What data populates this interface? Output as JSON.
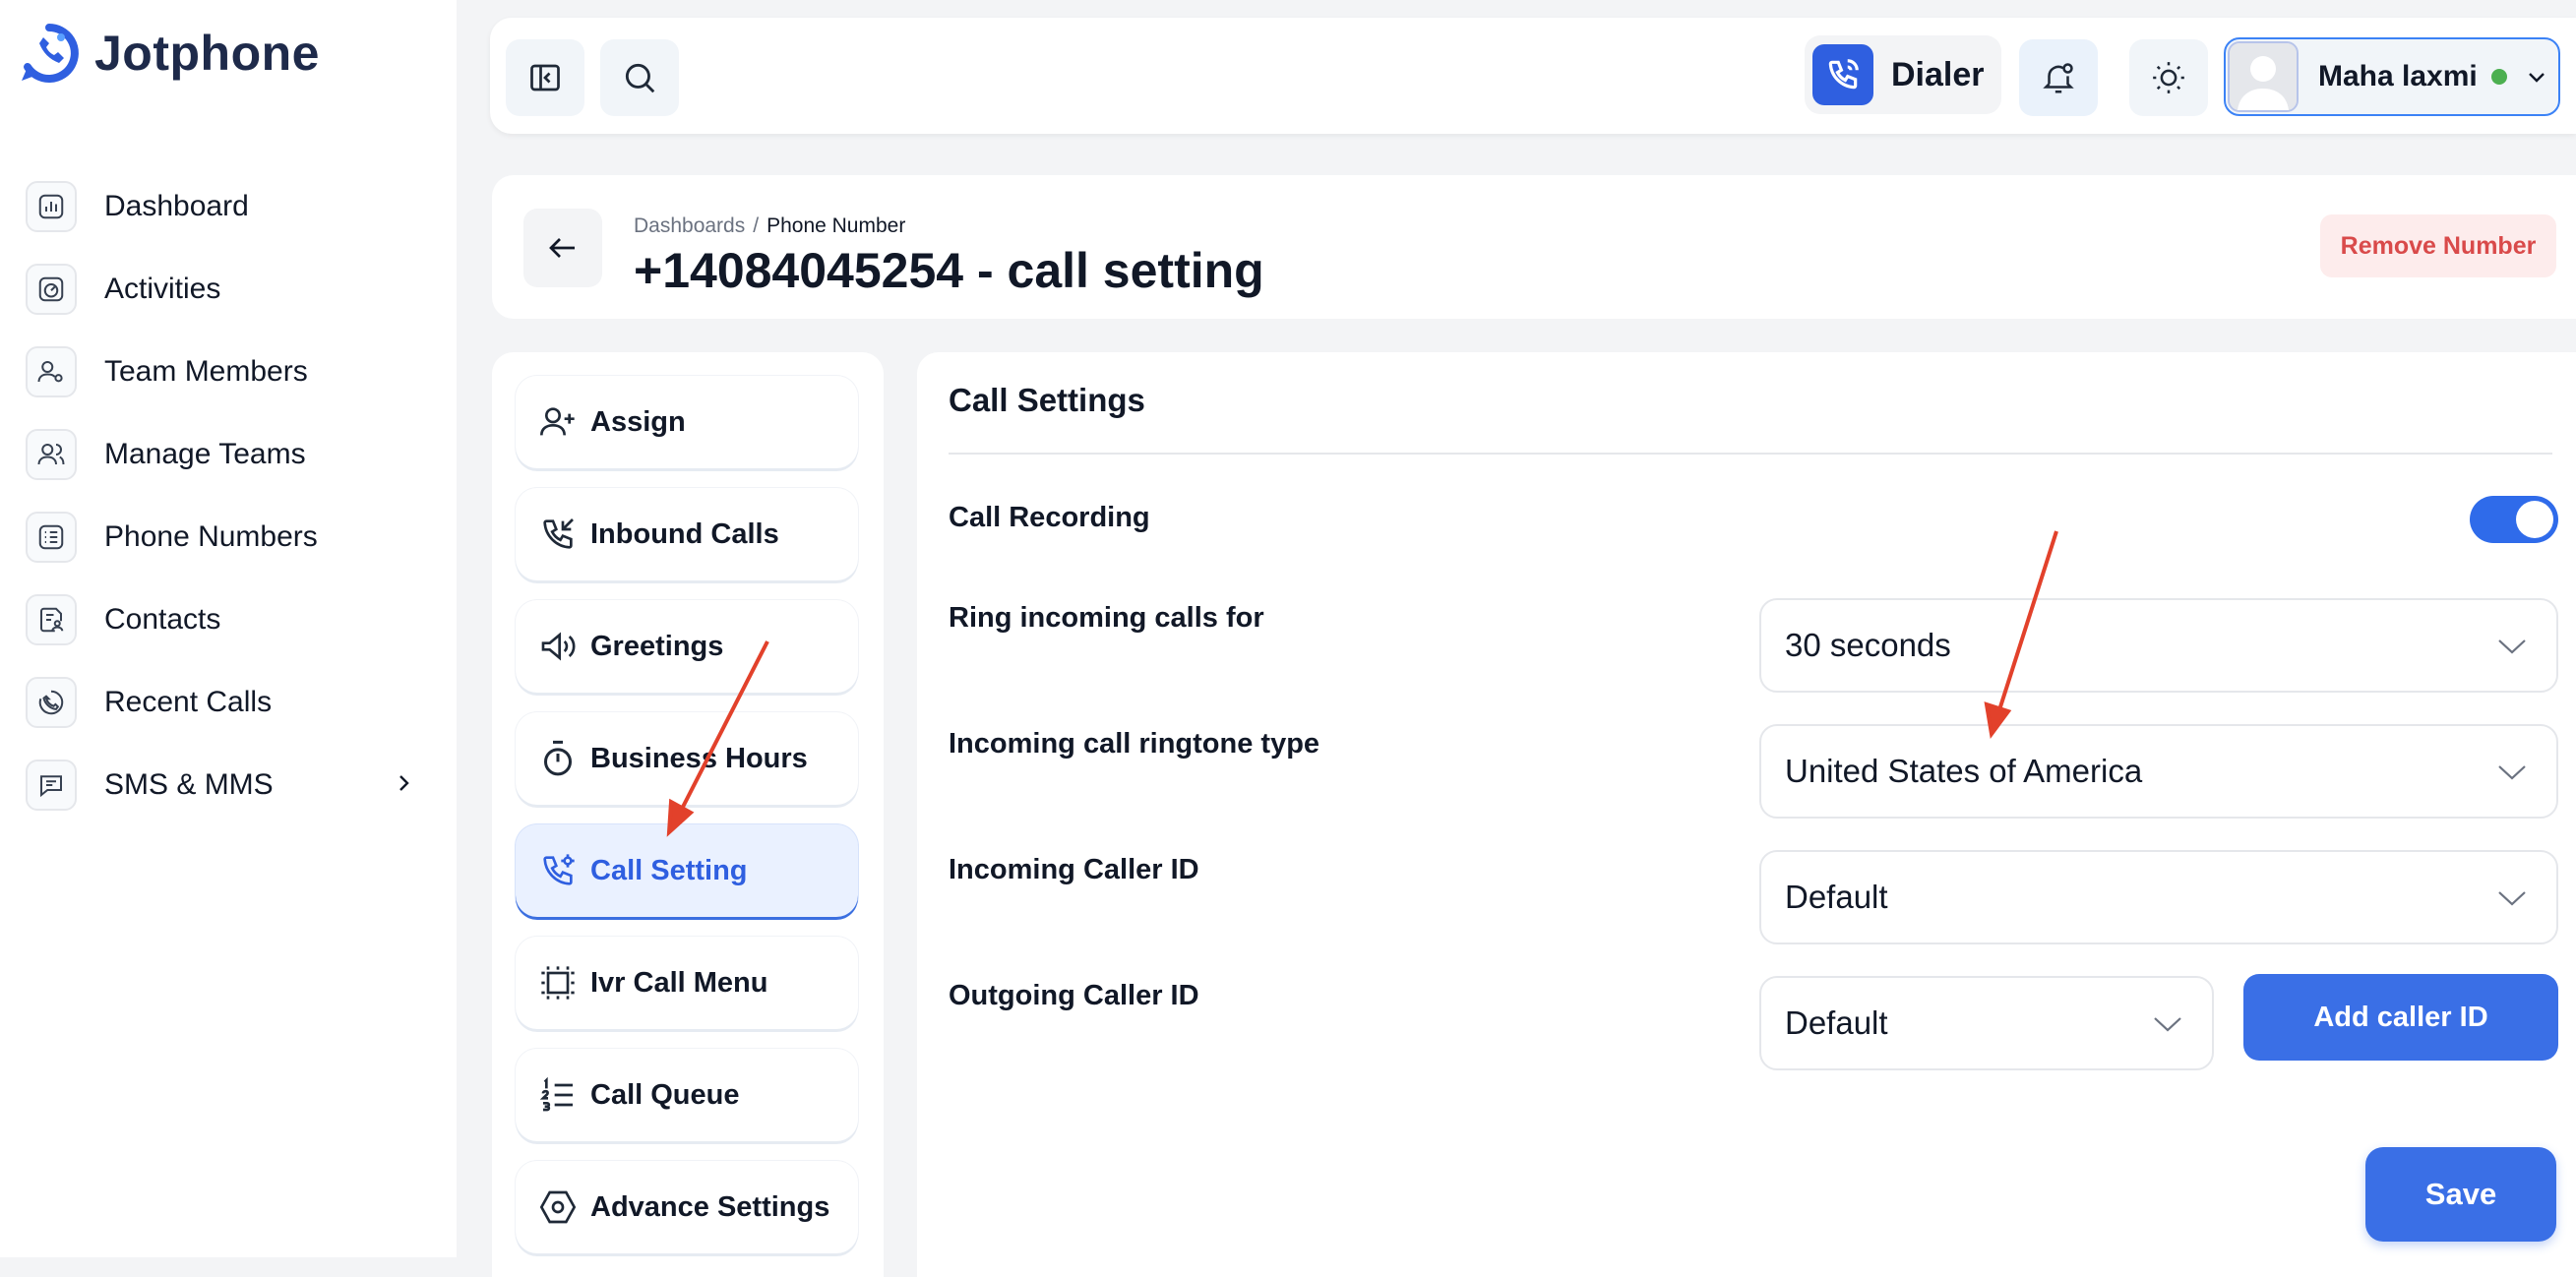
{
  "brand": {
    "name": "Jotphone"
  },
  "sidebar": {
    "items": [
      {
        "label": "Dashboard",
        "icon": "chart-icon"
      },
      {
        "label": "Activities",
        "icon": "activity-icon"
      },
      {
        "label": "Team Members",
        "icon": "user-gear-icon"
      },
      {
        "label": "Manage Teams",
        "icon": "users-icon"
      },
      {
        "label": "Phone Numbers",
        "icon": "list-icon"
      },
      {
        "label": "Contacts",
        "icon": "contact-card-icon"
      },
      {
        "label": "Recent Calls",
        "icon": "phone-history-icon"
      },
      {
        "label": "SMS & MMS",
        "icon": "chat-icon"
      }
    ]
  },
  "topbar": {
    "dialer_label": "Dialer",
    "user_name": "Maha laxmi",
    "user_status": "online"
  },
  "header": {
    "breadcrumb_root": "Dashboards",
    "breadcrumb_sep": "/",
    "breadcrumb_current": "Phone Number",
    "title": "+14084045254 - call setting",
    "remove_label": "Remove Number"
  },
  "menu": {
    "items": [
      {
        "label": "Assign",
        "icon": "user-plus-icon",
        "active": false
      },
      {
        "label": "Inbound Calls",
        "icon": "phone-incoming-icon",
        "active": false
      },
      {
        "label": "Greetings",
        "icon": "megaphone-icon",
        "active": false
      },
      {
        "label": "Business Hours",
        "icon": "stopwatch-icon",
        "active": false
      },
      {
        "label": "Call Setting",
        "icon": "phone-settings-icon",
        "active": true
      },
      {
        "label": "Ivr Call Menu",
        "icon": "ivr-frame-icon",
        "active": false
      },
      {
        "label": "Call Queue",
        "icon": "numbered-list-icon",
        "active": false
      },
      {
        "label": "Advance Settings",
        "icon": "hexagon-settings-icon",
        "active": false
      }
    ]
  },
  "settings": {
    "section_title": "Call Settings",
    "call_recording_label": "Call Recording",
    "call_recording_on": true,
    "ring_label": "Ring incoming calls for",
    "ring_value": "30 seconds",
    "ringtone_label": "Incoming call ringtone type",
    "ringtone_value": "United States of America",
    "incoming_id_label": "Incoming Caller ID",
    "incoming_id_value": "Default",
    "outgoing_id_label": "Outgoing Caller ID",
    "outgoing_id_value": "Default",
    "add_caller_label": "Add caller ID",
    "save_label": "Save"
  },
  "colors": {
    "accent": "#3a6fe6",
    "danger": "#d94a4a",
    "annotation": "#e2412b"
  }
}
